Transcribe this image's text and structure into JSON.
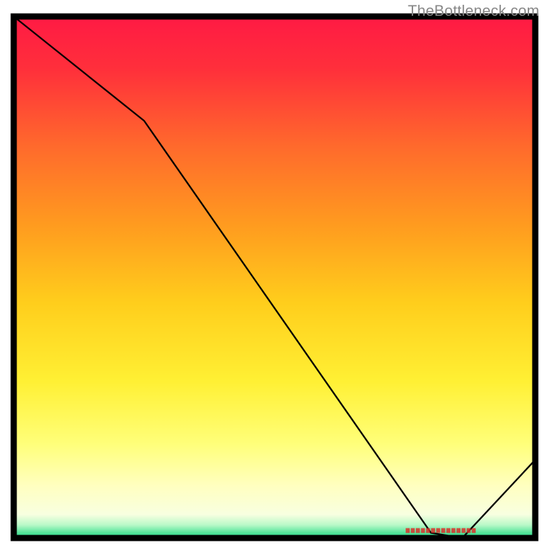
{
  "watermark": "TheBottleneck.com",
  "chart_data": {
    "type": "line",
    "title": "",
    "xlabel": "",
    "ylabel": "",
    "xlim": [
      0,
      100
    ],
    "ylim": [
      0,
      100
    ],
    "grid": false,
    "background": {
      "type": "vertical-gradient",
      "stops": [
        {
          "offset": 0.0,
          "color": "#ff1a44"
        },
        {
          "offset": 0.1,
          "color": "#ff2f3b"
        },
        {
          "offset": 0.25,
          "color": "#ff6a2c"
        },
        {
          "offset": 0.4,
          "color": "#ff9b1f"
        },
        {
          "offset": 0.55,
          "color": "#ffce1c"
        },
        {
          "offset": 0.7,
          "color": "#fff034"
        },
        {
          "offset": 0.82,
          "color": "#ffff7a"
        },
        {
          "offset": 0.9,
          "color": "#ffffc0"
        },
        {
          "offset": 0.955,
          "color": "#f8ffe0"
        },
        {
          "offset": 0.975,
          "color": "#b9f9c8"
        },
        {
          "offset": 0.99,
          "color": "#55e49a"
        },
        {
          "offset": 1.0,
          "color": "#1fd488"
        }
      ]
    },
    "series": [
      {
        "name": "curve",
        "color": "#000000",
        "x": [
          0,
          25,
          80,
          86,
          100
        ],
        "y": [
          100,
          80,
          1,
          0,
          15
        ]
      }
    ],
    "annotations": [
      {
        "text_illegible": true,
        "approx_x": 82,
        "approx_y": 1.5,
        "color": "#d9302a"
      }
    ]
  }
}
